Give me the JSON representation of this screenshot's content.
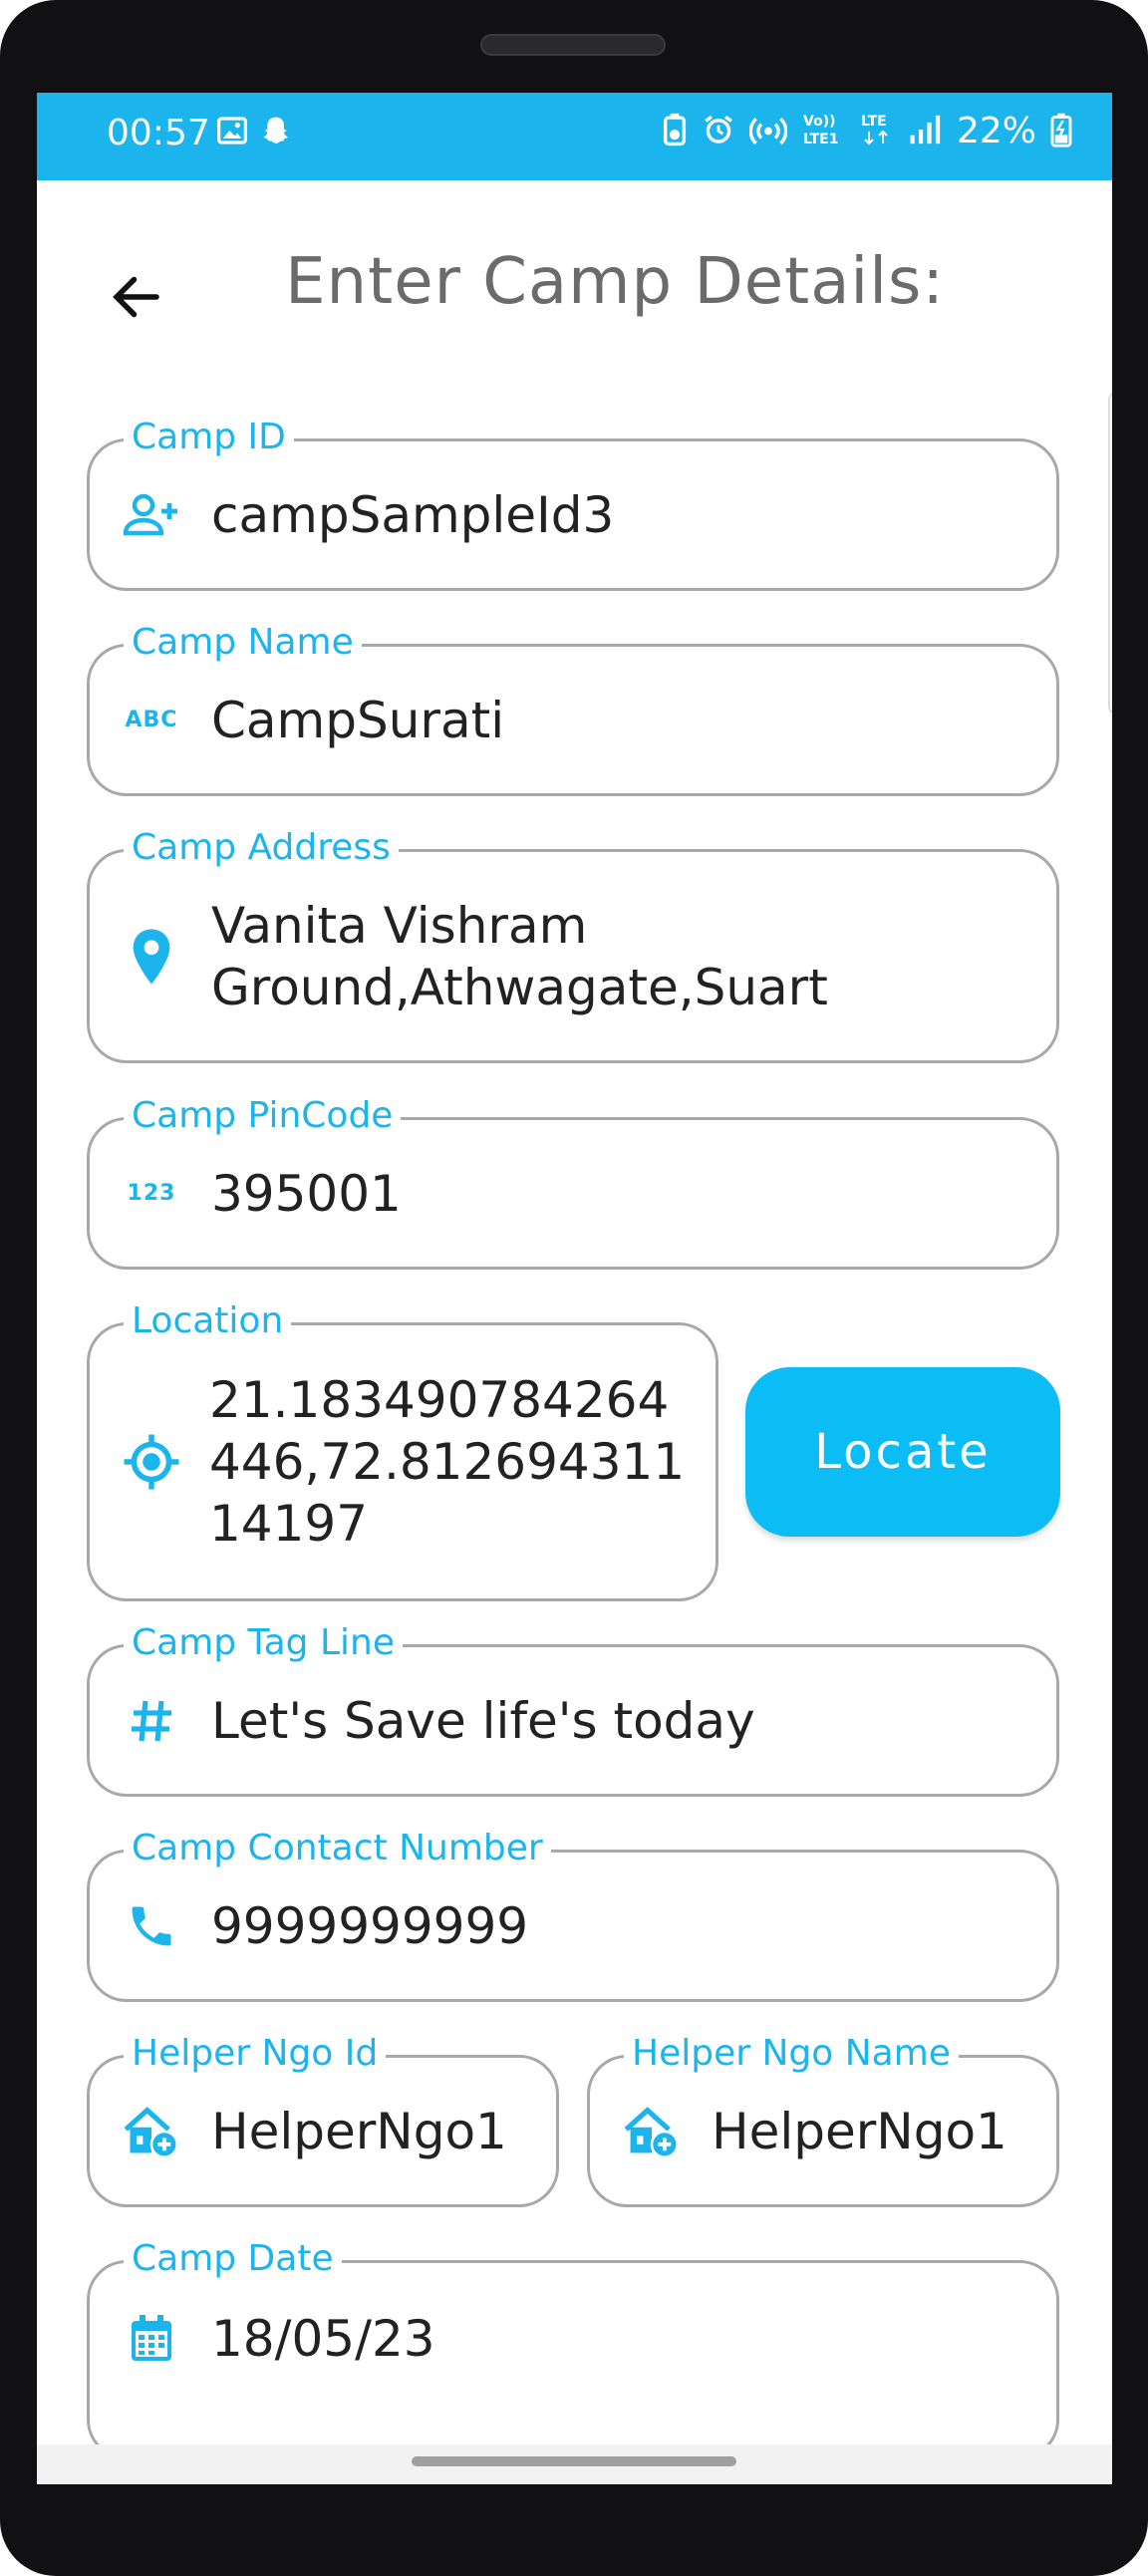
{
  "status_bar": {
    "time": "00:57",
    "battery": "22%",
    "left_icons": [
      "image-icon",
      "snapchat-icon"
    ],
    "right_icons": [
      "battery-saver-icon",
      "alarm-icon",
      "hotspot-icon",
      "volte-icon",
      "lte-icon",
      "signal-icon",
      "battery-charging-icon"
    ],
    "volte_text": "Vo)) LTE1",
    "lte_text": "LTE"
  },
  "header": {
    "title": "Enter Camp Details:",
    "back_icon": "arrow-left-icon"
  },
  "form": {
    "camp_id": {
      "label": "Camp ID",
      "value": "campSampleId3",
      "icon": "person-add-icon"
    },
    "camp_name": {
      "label": "Camp Name",
      "value": "CampSurati",
      "icon": "abc-icon",
      "icon_text": "ABC"
    },
    "camp_address": {
      "label": "Camp Address",
      "value": "Vanita Vishram Ground,Athwagate,Suart",
      "icon": "location-pin-icon"
    },
    "camp_pincode": {
      "label": "Camp PinCode",
      "value": "395001",
      "icon": "numeric-icon",
      "icon_text": "123"
    },
    "location": {
      "label": "Location",
      "value": "21.183490784264446,72.81269431114197",
      "icon": "gps-fixed-icon"
    },
    "locate_button": {
      "label": "Locate"
    },
    "camp_tag_line": {
      "label": "Camp Tag Line",
      "value": "Let's Save life's today",
      "icon": "hashtag-icon"
    },
    "camp_contact": {
      "label": "Camp Contact Number",
      "value": "9999999999",
      "icon": "phone-icon"
    },
    "helper_ngo_id": {
      "label": "Helper Ngo Id",
      "value": "HelperNgo1",
      "icon": "add-home-icon"
    },
    "helper_ngo_name": {
      "label": "Helper Ngo Name",
      "value": "HelperNgo1",
      "icon": "add-home-icon"
    },
    "camp_date": {
      "label": "Camp Date",
      "value": "18/05/23",
      "icon": "calendar-icon"
    }
  },
  "colors": {
    "accent": "#1cb4ec",
    "button": "#0bbcf5",
    "title": "#6b6b6b",
    "border": "#a8a8a8"
  }
}
